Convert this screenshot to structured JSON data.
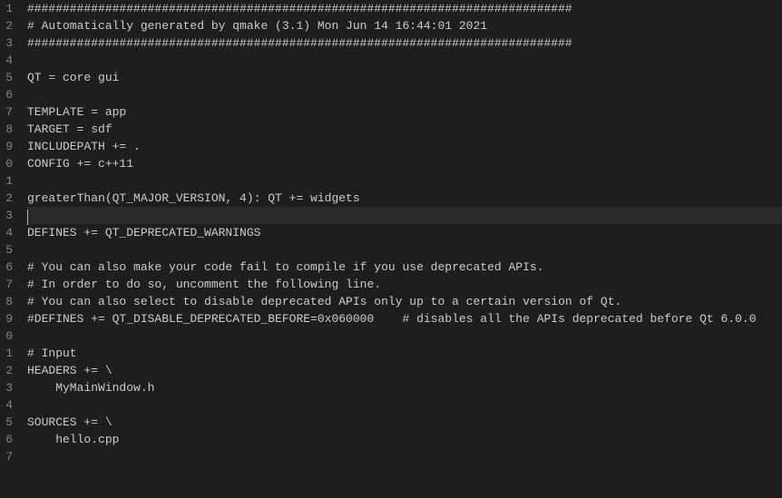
{
  "editor": {
    "lineNumbers": [
      "1",
      "2",
      "3",
      "4",
      "5",
      "6",
      "7",
      "8",
      "9",
      "0",
      "1",
      "2",
      "3",
      "4",
      "5",
      "6",
      "7",
      "8",
      "9",
      "0",
      "1",
      "2",
      "3",
      "4",
      "5",
      "6",
      "7"
    ],
    "currentLine": 13,
    "lines": {
      "l1": "#############################################################################",
      "l2": "# Automatically generated by qmake (3.1) Mon Jun 14 16:44:01 2021",
      "l3": "#############################################################################",
      "l4": "",
      "l5": "QT = core gui",
      "l6": "",
      "l7": "TEMPLATE = app",
      "l8": "TARGET = sdf",
      "l9": "INCLUDEPATH += .",
      "l10": "CONFIG += c++11",
      "l11": "",
      "l12": "greaterThan(QT_MAJOR_VERSION, 4): QT += widgets",
      "l13": "",
      "l14": "DEFINES += QT_DEPRECATED_WARNINGS",
      "l15": "",
      "l16": "# You can also make your code fail to compile if you use deprecated APIs.",
      "l17": "# In order to do so, uncomment the following line.",
      "l18": "# You can also select to disable deprecated APIs only up to a certain version of Qt.",
      "l19": "#DEFINES += QT_DISABLE_DEPRECATED_BEFORE=0x060000    # disables all the APIs deprecated before Qt 6.0.0",
      "l20": "",
      "l21": "# Input",
      "l22": "HEADERS += \\",
      "l23": "    MyMainWindow.h",
      "l24": "",
      "l25": "SOURCES += \\",
      "l26": "    hello.cpp",
      "l27": ""
    }
  }
}
